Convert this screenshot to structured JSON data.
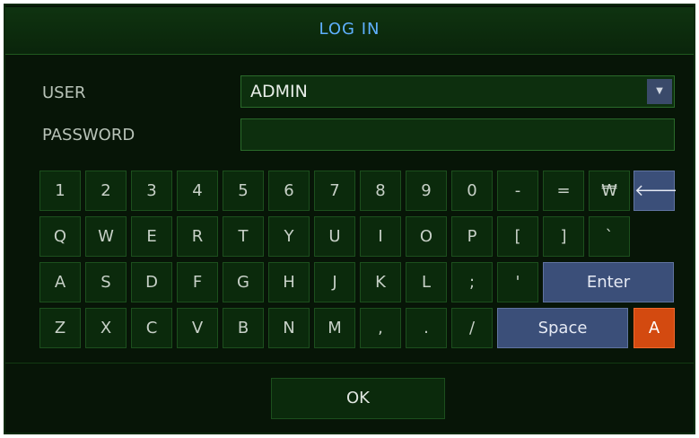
{
  "dialog": {
    "title": "LOG IN",
    "user_label": "USER",
    "user_value": "ADMIN",
    "dropdown_icon": "chevron-down-icon",
    "password_label": "PASSWORD",
    "password_value": ""
  },
  "keyboard": {
    "row1": [
      "1",
      "2",
      "3",
      "4",
      "5",
      "6",
      "7",
      "8",
      "9",
      "0",
      "-",
      "=",
      "₩"
    ],
    "backspace_glyph": "🡐",
    "row2": [
      "Q",
      "W",
      "E",
      "R",
      "T",
      "Y",
      "U",
      "I",
      "O",
      "P",
      "[",
      "]",
      "`"
    ],
    "row3": [
      "A",
      "S",
      "D",
      "F",
      "G",
      "H",
      "J",
      "K",
      "L",
      ";",
      "'"
    ],
    "enter_label": "Enter",
    "row4": [
      "Z",
      "X",
      "C",
      "V",
      "B",
      "N",
      "M",
      ",",
      ".",
      "/"
    ],
    "space_label": "Space",
    "case_label": "A"
  },
  "footer": {
    "ok_label": "OK"
  }
}
